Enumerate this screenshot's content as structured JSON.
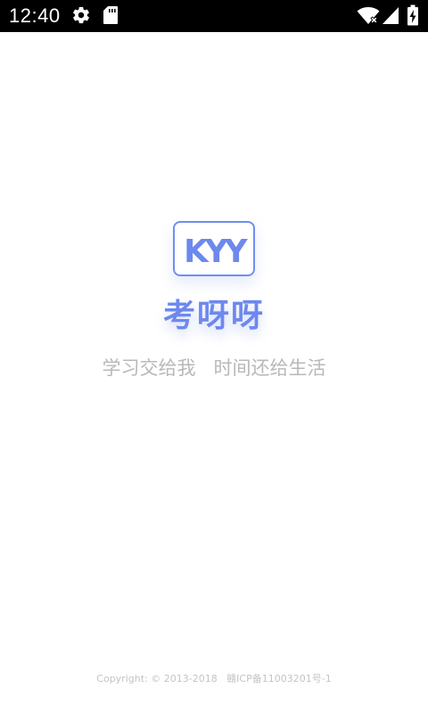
{
  "status_bar": {
    "time": "12:40",
    "icons": [
      "gear-icon",
      "sd-card-icon",
      "wifi-icon",
      "cell-signal-icon",
      "battery-charging-icon"
    ]
  },
  "splash": {
    "logo_text": "KYY",
    "app_name": "考呀呀",
    "slogan": "学习交给我   时间还给生活",
    "accent_color": "#6d88ee"
  },
  "footer": {
    "copyright": "Copyright: © 2013-2018   赣ICP备11003201号-1"
  }
}
